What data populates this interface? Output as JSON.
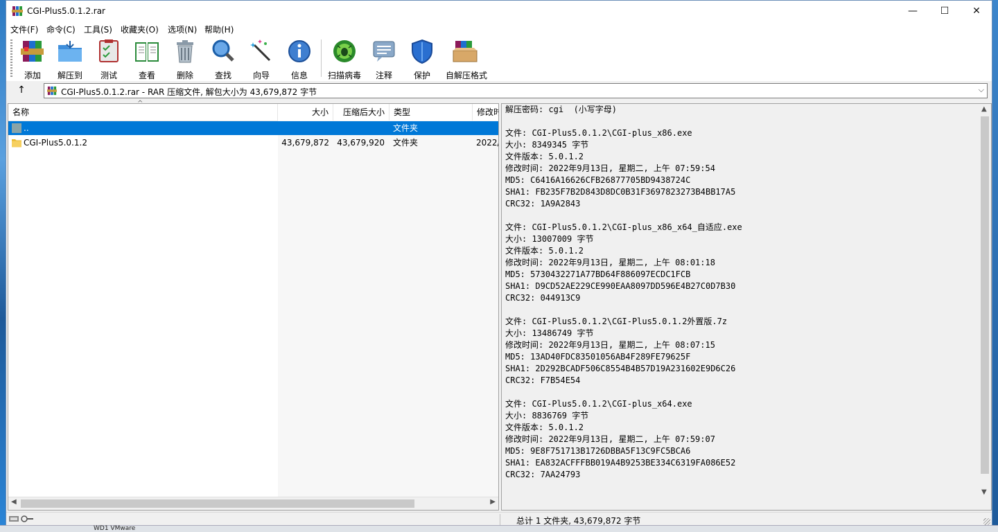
{
  "window": {
    "title": "CGI-Plus5.0.1.2.rar",
    "minimize": "—",
    "maximize": "☐",
    "close": "✕"
  },
  "menu": [
    "文件(F)",
    "命令(C)",
    "工具(S)",
    "收藏夹(O)",
    "选项(N)",
    "帮助(H)"
  ],
  "toolbar": [
    {
      "label": "添加",
      "icon": "add-archive-icon"
    },
    {
      "label": "解压到",
      "icon": "extract-folder-icon"
    },
    {
      "label": "测试",
      "icon": "test-clipboard-icon"
    },
    {
      "label": "查看",
      "icon": "view-book-icon"
    },
    {
      "label": "删除",
      "icon": "trash-icon"
    },
    {
      "label": "查找",
      "icon": "magnifier-icon"
    },
    {
      "label": "向导",
      "icon": "wizard-wand-icon"
    },
    {
      "label": "信息",
      "icon": "info-icon"
    },
    {
      "label": "扫描病毒",
      "icon": "virus-scan-icon"
    },
    {
      "label": "注释",
      "icon": "comment-icon"
    },
    {
      "label": "保护",
      "icon": "shield-icon"
    },
    {
      "label": "自解压格式",
      "icon": "sfx-box-icon"
    }
  ],
  "address": {
    "up_icon": "↑",
    "text": "CGI-Plus5.0.1.2.rar - RAR 压缩文件, 解包大小为 43,679,872 字节",
    "dropdown": "⌵"
  },
  "columns": {
    "name": "名称",
    "size": "大小",
    "packed": "压缩后大小",
    "type": "类型",
    "modified": "修改时"
  },
  "rows": [
    {
      "name": "..",
      "size": "",
      "packed": "",
      "type": "文件夹",
      "modified": ""
    },
    {
      "name": "CGI-Plus5.0.1.2",
      "size": "43,679,872",
      "packed": "43,679,920",
      "type": "文件夹",
      "modified": "2022/"
    }
  ],
  "info_lines": [
    "解压密码: cgi  (小写字母)",
    "",
    "文件: CGI-Plus5.0.1.2\\CGI-plus_x86.exe",
    "大小: 8349345 字节",
    "文件版本: 5.0.1.2",
    "修改时间: 2022年9月13日, 星期二, 上午 07:59:54",
    "MD5: C6416A16626CFB26877705BD9438724C",
    "SHA1: FB235F7B2D843D8DC0B31F3697823273B4BB17A5",
    "CRC32: 1A9A2843",
    "",
    "文件: CGI-Plus5.0.1.2\\CGI-plus_x86_x64_自适应.exe",
    "大小: 13007009 字节",
    "文件版本: 5.0.1.2",
    "修改时间: 2022年9月13日, 星期二, 上午 08:01:18",
    "MD5: 5730432271A77BD64F886097ECDC1FCB",
    "SHA1: D9CD52AE229CE990EAA8097DD596E4B27C0D7B30",
    "CRC32: 044913C9",
    "",
    "文件: CGI-Plus5.0.1.2\\CGI-Plus5.0.1.2外置版.7z",
    "大小: 13486749 字节",
    "修改时间: 2022年9月13日, 星期二, 上午 08:07:15",
    "MD5: 13AD40FDC83501056AB4F289FE79625F",
    "SHA1: 2D292BCADF506C8554B4B57D19A231602E9D6C26",
    "CRC32: F7B54E54",
    "",
    "文件: CGI-Plus5.0.1.2\\CGI-plus_x64.exe",
    "大小: 8836769 字节",
    "文件版本: 5.0.1.2",
    "修改时间: 2022年9月13日, 星期二, 上午 07:59:07",
    "MD5: 9E8F751713B1726DBBA5F13C9FC5BCA6",
    "SHA1: EA832ACFFFBB019A4B9253BE334C6319FA086E52",
    "CRC32: 7AA24793"
  ],
  "status": {
    "text": "总计 1 文件夹, 43,679,872 字节"
  },
  "taskbar": {
    "peek_text": "WD1 VMware"
  },
  "colors": {
    "selection": "#0078d7",
    "window_bg": "#f0f0f0",
    "desktop": "#1f6fb5"
  }
}
